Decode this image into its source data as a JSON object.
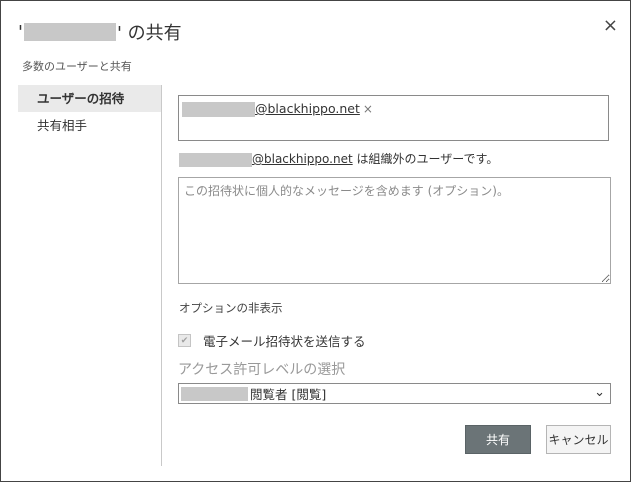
{
  "dialog": {
    "title_prefix": "'",
    "title_suffix": "' の共有",
    "close_glyph": "×",
    "subtitle": "多数のユーザーと共有"
  },
  "sidebar": {
    "items": [
      {
        "label": "ユーザーの招待",
        "active": true
      },
      {
        "label": "共有相手",
        "active": false
      }
    ]
  },
  "invite": {
    "recipient_domain": "@blackhippo.net",
    "remove_glyph": "×",
    "warning_domain": "@blackhippo.net",
    "warning_suffix": " は組織外のユーザーです。",
    "message_placeholder": "この招待状に個人的なメッセージを含めます (オプション)。"
  },
  "options": {
    "toggle_label": "オプションの非表示",
    "send_email_label": "電子メール招待状を送信する",
    "send_email_checked": true,
    "send_email_disabled": true,
    "permission_label": "アクセス許可レベルの選択",
    "permission_value": "閲覧者 [閲覧]"
  },
  "buttons": {
    "share": "共有",
    "cancel": "キャンセル"
  },
  "colors": {
    "primary_button": "#6b7477",
    "redaction": "#c8c8c8"
  }
}
